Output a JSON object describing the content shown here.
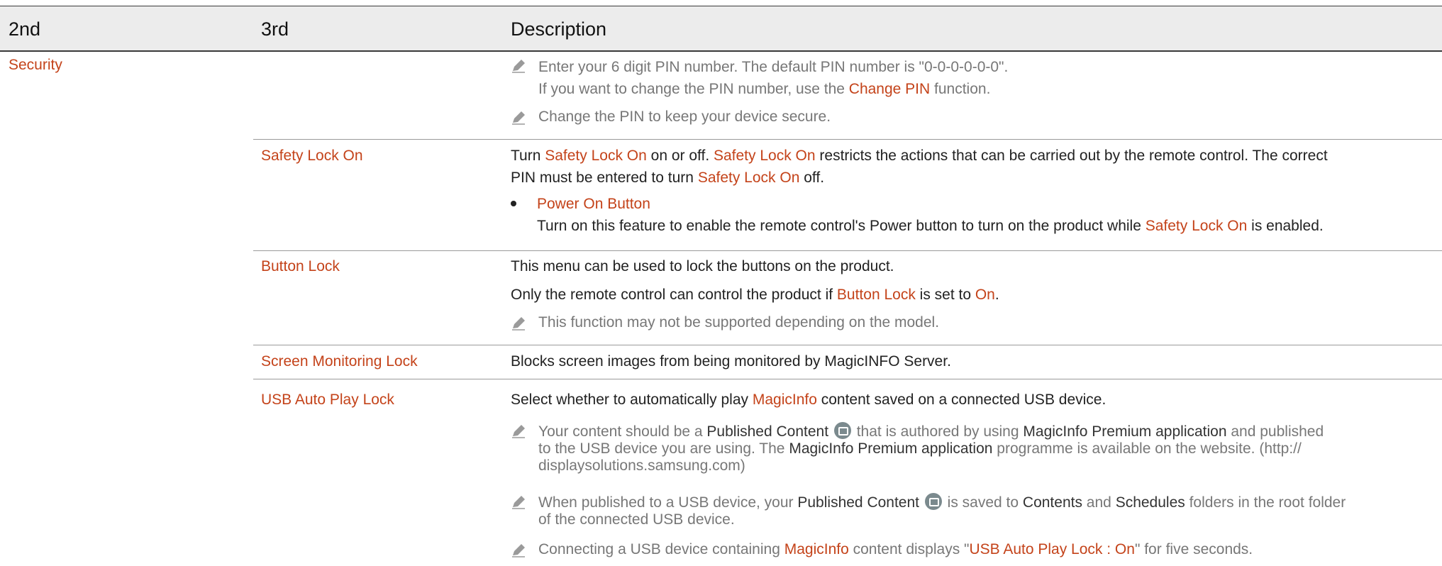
{
  "header": {
    "col_2nd": "2nd",
    "col_3rd": "3rd",
    "col_desc": "Description"
  },
  "section": {
    "label": "Security"
  },
  "security_notes": {
    "note1_line1": "Enter your 6 digit PIN number. The default PIN number is \"0-0-0-0-0-0\".",
    "note1_line2_pre": "If you want to change the PIN number, use the ",
    "note1_line2_link": "Change PIN",
    "note1_line2_post": " function.",
    "note2": "Change the PIN to keep your device secure."
  },
  "safety_lock": {
    "label": "Safety Lock On",
    "desc_p1": "Turn ",
    "desc_l1": "Safety Lock On",
    "desc_p2": " on or off. ",
    "desc_l2": "Safety Lock On",
    "desc_p3": " restricts the actions that can be carried out by the remote control. The correct",
    "desc_p4": "PIN must be entered to turn ",
    "desc_l3": "Safety Lock On",
    "desc_p5": " off.",
    "bullet_title": "Power On Button",
    "bullet_text_pre": "Turn on this feature to enable the remote control's Power button to turn on the product while ",
    "bullet_text_link": "Safety Lock On",
    "bullet_text_post": " is enabled."
  },
  "button_lock": {
    "label": "Button Lock",
    "desc1": "This menu can be used to lock the buttons on the product.",
    "desc2_pre": "Only the remote control can control the product if ",
    "desc2_link1": "Button Lock",
    "desc2_mid": " is set to ",
    "desc2_link2": "On",
    "desc2_post": ".",
    "note": "This function may not be supported depending on the model."
  },
  "screen_monitoring": {
    "label": "Screen Monitoring Lock",
    "desc": "Blocks screen images from being monitored by MagicINFO Server."
  },
  "usb_lock": {
    "label": "USB Auto Play Lock",
    "desc_pre": "Select whether to automatically play ",
    "desc_link": "MagicInfo",
    "desc_post": " content saved on a connected USB device.",
    "note1_a": "Your content should be a ",
    "note1_b": "Published Content",
    "note1_c": " that is authored by using ",
    "note1_d": "MagicInfo Premium application",
    "note1_e": " and published",
    "note1_f": "to the USB device you are using. The ",
    "note1_g": "MagicInfo Premium application",
    "note1_h": " programme is available on the website. (http://",
    "note1_i": "displaysolutions.samsung.com)",
    "note2_a": "When published to a USB device, your ",
    "note2_b": "Published Content",
    "note2_c": " is saved to ",
    "note2_d": "Contents",
    "note2_e": " and ",
    "note2_f": "Schedules",
    "note2_g": " folders in the root folder",
    "note2_h": "of the connected USB device.",
    "note3_a": "Connecting a USB device containing ",
    "note3_b": "MagicInfo",
    "note3_c": " content displays \"",
    "note3_d": "USB Auto Play Lock : On",
    "note3_e": "\" for five seconds."
  },
  "colors": {
    "accent": "#c4431a",
    "note_gray": "#777777",
    "header_bg": "#ececec"
  },
  "icons": {
    "note": "pencil-note-icon",
    "content": "published-content-icon"
  }
}
